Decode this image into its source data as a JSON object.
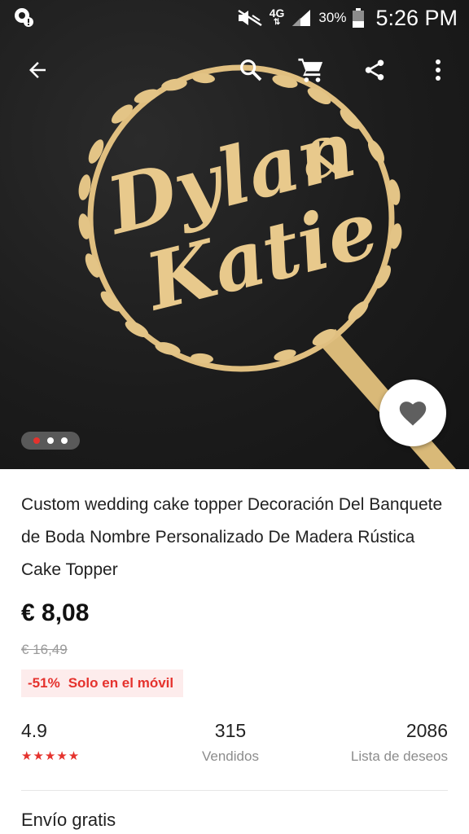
{
  "status_bar": {
    "battery": "30%",
    "time": "5:26 PM",
    "network": "4G"
  },
  "toolbar": {
    "icons": [
      "back-arrow-icon",
      "search-icon",
      "cart-icon",
      "share-icon",
      "more-vert-icon"
    ]
  },
  "hero": {
    "image_text_line1": "Dylan",
    "image_text_amp": "&",
    "image_text_line2": "Katie",
    "pager_count": 3,
    "pager_active": 0
  },
  "product": {
    "title": "Custom wedding cake topper Decoración Del Banquete de Boda Nombre Personalizado De Madera Rústica Cake Topper",
    "price": "€ 8,08",
    "old_price": "€ 16,49",
    "discount": "-51%",
    "promo_label": "Solo en el móvil"
  },
  "stats": {
    "rating": "4.9",
    "stars": "★★★★★",
    "sold_count": "315",
    "sold_label": "Vendidos",
    "wishlist_count": "2086",
    "wishlist_label": "Lista de deseos"
  },
  "shipping": {
    "label": "Envío gratis"
  },
  "colors": {
    "accent": "#e5322d",
    "promo_bg": "#fdecec",
    "wood": "#e3c486"
  }
}
